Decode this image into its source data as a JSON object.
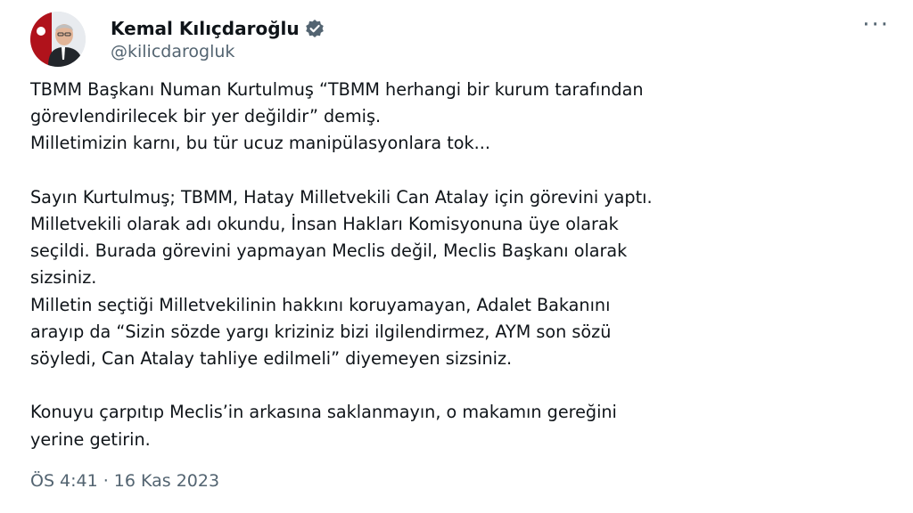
{
  "author": {
    "display_name": "Kemal Kılıçdaroğlu",
    "handle": "@kilicdarogluk",
    "verified": true,
    "verified_color": "#536471"
  },
  "menu": {
    "more_label": "···"
  },
  "tweet": {
    "paragraph1": [
      "TBMM Başkanı Numan Kurtulmuş “TBMM herhangi bir kurum tarafından",
      "görevlendirilecek bir yer değildir” demiş.",
      "Milletimizin karnı, bu tür ucuz manipülasyonlara tok..."
    ],
    "paragraph2": [
      "Sayın Kurtulmuş; TBMM, Hatay Milletvekili Can Atalay için görevini yaptı.",
      "Milletvekili olarak adı okundu, İnsan Hakları Komisyonuna üye olarak",
      "seçildi. Burada görevini yapmayan Meclis değil, Meclis Başkanı olarak",
      "sizsiniz.",
      "Milletin seçtiği Milletvekilinin hakkını koruyamayan, Adalet Bakanını",
      "arayıp da “Sizin sözde yargı kriziniz bizi ilgilendirmez, AYM son sözü",
      "söyledi, Can Atalay tahliye edilmeli” diyemeyen sizsiniz."
    ],
    "paragraph3": [
      "Konuyu çarpıtıp Meclis’in arkasına saklanmayın, o makamın gereğini",
      "yerine getirin."
    ],
    "time": "ÖS 4:41",
    "separator": "·",
    "date": "16 Kas 2023"
  },
  "colors": {
    "text": "#0f1419",
    "secondary": "#536471"
  }
}
